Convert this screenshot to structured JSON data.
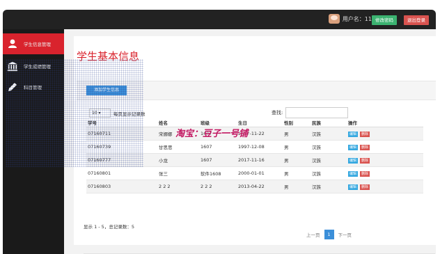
{
  "header": {
    "user_label": "用户名：11",
    "change_password": "修改密码",
    "logout": "退出登录"
  },
  "sidebar": {
    "items": [
      {
        "label": "学生信息管理",
        "icon": "user-icon"
      },
      {
        "label": "学生成绩管理",
        "icon": "bank-icon"
      },
      {
        "label": "科目管理",
        "icon": "pencil-icon"
      }
    ]
  },
  "main": {
    "title": "学生基本信息",
    "add_button": "添加学生信息",
    "page_size": "10",
    "page_size_label": "每页显示记录数",
    "search_label": "查找:",
    "search_value": "",
    "columns": [
      "学号",
      "姓名",
      "班级",
      "生日",
      "性别",
      "民族",
      "操作"
    ],
    "rows": [
      {
        "id": "07160711",
        "name": "宋娜娜",
        "class": "1607",
        "birthday": "2017-11-22",
        "gender": "男",
        "ethnic": "汉族"
      },
      {
        "id": "07160739",
        "name": "甘思思",
        "class": "1607",
        "birthday": "1997-12-08",
        "gender": "男",
        "ethnic": "汉族"
      },
      {
        "id": "07160777",
        "name": "小龙",
        "class": "1607",
        "birthday": "2017-11-16",
        "gender": "男",
        "ethnic": "汉族"
      },
      {
        "id": "07160801",
        "name": "张三",
        "class": "软件1608",
        "birthday": "2000-01-01",
        "gender": "男",
        "ethnic": "汉族"
      },
      {
        "id": "07160803",
        "name": "2 2 2",
        "class": "2 2 2",
        "birthday": "2013-04-22",
        "gender": "男",
        "ethnic": "汉族"
      }
    ],
    "edit_label": "编辑",
    "delete_label": "删除",
    "summary": "显示 1 - 5，总记录数：5",
    "pager": {
      "prev": "上一页",
      "current": "1",
      "next": "下一页"
    }
  },
  "watermark": "淘宝：豆子一号铺",
  "colors": {
    "accent_red": "#d9232d",
    "blue": "#3b8fd9",
    "green": "#3cb371"
  }
}
